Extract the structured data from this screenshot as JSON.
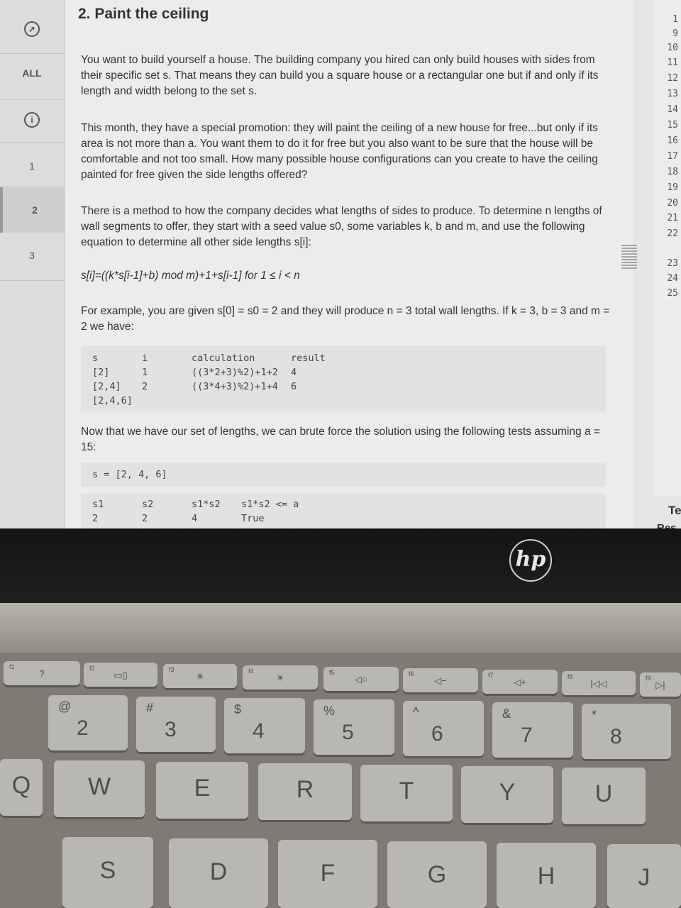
{
  "sidebar": {
    "items": [
      {
        "label": "",
        "icon": "compass-icon"
      },
      {
        "label": "ALL"
      },
      {
        "label": "",
        "icon": "info-icon"
      },
      {
        "label": "1"
      },
      {
        "label": "2"
      },
      {
        "label": "3"
      }
    ]
  },
  "problem": {
    "title": "2. Paint the ceiling",
    "p1": "You want to build yourself a house. The building company you hired can only build houses with sides from their specific set s. That means they can build you a square house or a rectangular one but if and only if its length and width belong to the set s.",
    "p2": "This month, they have a special promotion: they will paint the ceiling of a new house for free...but only if its area is not more than a. You want them to do it for free but you also want to be sure that the house will be comfortable and not too small. How many possible house configurations can you create to have the ceiling painted for free given the side lengths offered?",
    "p3": "There is a method to how the company decides what lengths of sides to produce. To determine n lengths of wall segments to offer, they start with a seed value s0, some variables k, b and m, and use the following equation to determine all other side lengths s[i]:",
    "equation": "s[i]=((k*s[i-1]+b) mod m)+1+s[i-1] for 1 ≤ i < n",
    "p4": "For example, you are given s[0] = s0 = 2 and they will produce n = 3 total wall lengths. If k = 3, b = 3 and m = 2 we have:",
    "table1": {
      "headers": [
        "s",
        "i",
        "calculation",
        "result"
      ],
      "rows": [
        [
          "[2]",
          "1",
          "((3*2+3)%2)+1+2",
          "4"
        ],
        [
          "[2,4]",
          "2",
          "((3*4+3)%2)+1+4",
          "6"
        ],
        [
          "[2,4,6]",
          "",
          "",
          ""
        ]
      ]
    },
    "p5": "Now that we have our set of lengths, we can brute force the solution using the following tests assuming a = 15:",
    "code_s": "s = [2, 4, 6]",
    "table2": {
      "headers": [
        "s1",
        "s2",
        "s1*s2",
        "s1*s2 <= a"
      ],
      "rows": [
        [
          "2",
          "2",
          "4",
          "True"
        ]
      ]
    }
  },
  "gutter": {
    "line_numbers": [
      "1",
      "9",
      "10",
      "11",
      "12",
      "13",
      "14",
      "15",
      "16",
      "17",
      "18",
      "19",
      "20",
      "21",
      "22",
      "23",
      "24",
      "25"
    ],
    "panel_text_1": "Te",
    "panel_text_2": "Res"
  },
  "laptop": {
    "logo": "hp",
    "fkeys": [
      {
        "small": "f1",
        "icon": "?"
      },
      {
        "small": "f2",
        "icon": "▭▯"
      },
      {
        "small": "f3",
        "icon": "☀"
      },
      {
        "small": "f4",
        "icon": "☀"
      },
      {
        "small": "f5",
        "icon": "◁○"
      },
      {
        "small": "f6",
        "icon": "◁−"
      },
      {
        "small": "f7",
        "icon": "◁+"
      },
      {
        "small": "f8",
        "icon": "|◁◁"
      },
      {
        "small": "f9",
        "icon": "▷|"
      }
    ],
    "numkeys": [
      {
        "top": "@",
        "bot": "2"
      },
      {
        "top": "#",
        "bot": "3"
      },
      {
        "top": "$",
        "bot": "4"
      },
      {
        "top": "%",
        "bot": "5"
      },
      {
        "top": "^",
        "bot": "6"
      },
      {
        "top": "&",
        "bot": "7"
      },
      {
        "top": "*",
        "bot": "8"
      }
    ],
    "row_q": [
      "Q",
      "W",
      "E",
      "R",
      "T",
      "Y",
      "U"
    ],
    "row_a": [
      "S",
      "D",
      "F",
      "G",
      "H",
      "J"
    ]
  }
}
